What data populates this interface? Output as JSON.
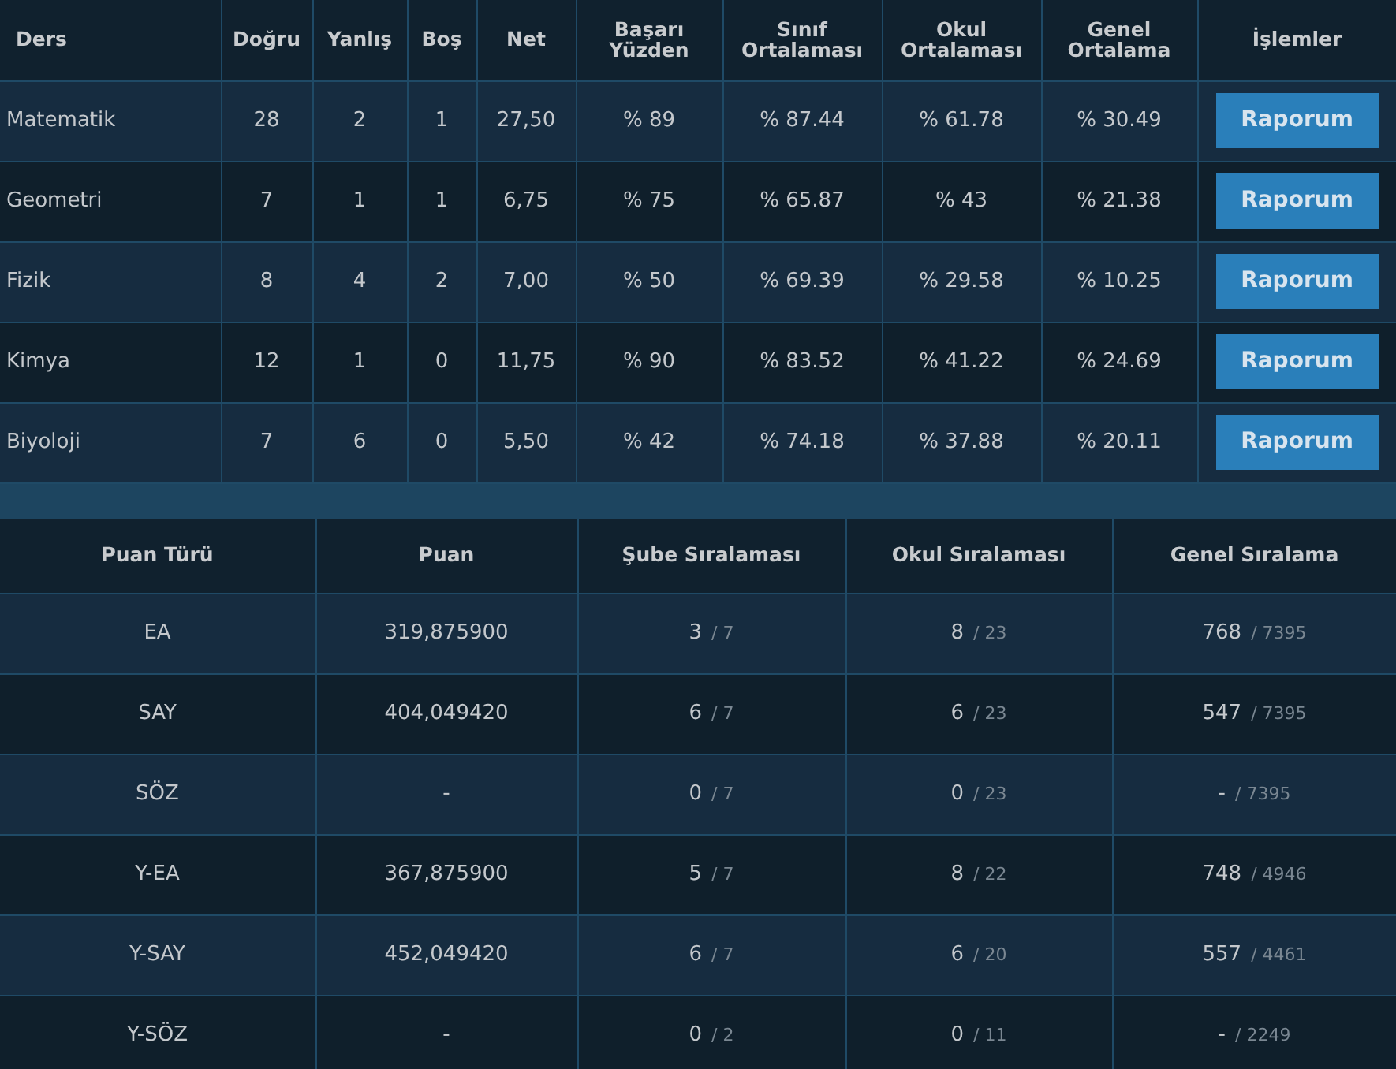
{
  "results_table": {
    "columns": [
      "Ders",
      "Doğru",
      "Yanlış",
      "Boş",
      "Net",
      "Başarı Yüzden",
      "Sınıf Ortalaması",
      "Okul Ortalaması",
      "Genel Ortalama",
      "İşlemler"
    ],
    "rows": [
      {
        "cells": [
          "Matematik",
          "28",
          "2",
          "1",
          "27,50",
          "% 89",
          "% 87.44",
          "% 61.78",
          "% 30.49"
        ],
        "button": "Raporum"
      },
      {
        "cells": [
          "Geometri",
          "7",
          "1",
          "1",
          "6,75",
          "% 75",
          "% 65.87",
          "% 43",
          "% 21.38"
        ],
        "button": "Raporum"
      },
      {
        "cells": [
          "Fizik",
          "8",
          "4",
          "2",
          "7,00",
          "% 50",
          "% 69.39",
          "% 29.58",
          "% 10.25"
        ],
        "button": "Raporum"
      },
      {
        "cells": [
          "Kimya",
          "12",
          "1",
          "0",
          "11,75",
          "% 90",
          "% 83.52",
          "% 41.22",
          "% 24.69"
        ],
        "button": "Raporum"
      },
      {
        "cells": [
          "Biyoloji",
          "7",
          "6",
          "0",
          "5,50",
          "% 42",
          "% 74.18",
          "% 37.88",
          "% 20.11"
        ],
        "button": "Raporum"
      }
    ]
  },
  "score_table": {
    "columns": [
      "Puan Türü",
      "Puan",
      "Şube Sıralaması",
      "Okul Sıralaması",
      "Genel Sıralama"
    ],
    "rows": [
      {
        "type": "EA",
        "score": "319,875900",
        "ranks": [
          {
            "rank": "3",
            "total": "/ 7"
          },
          {
            "rank": "8",
            "total": "/ 23"
          },
          {
            "rank": "768",
            "total": "/ 7395"
          }
        ]
      },
      {
        "type": "SAY",
        "score": "404,049420",
        "ranks": [
          {
            "rank": "6",
            "total": "/ 7"
          },
          {
            "rank": "6",
            "total": "/ 23"
          },
          {
            "rank": "547",
            "total": "/ 7395"
          }
        ]
      },
      {
        "type": "SÖZ",
        "score": "-",
        "ranks": [
          {
            "rank": "0",
            "total": "/ 7"
          },
          {
            "rank": "0",
            "total": "/ 23"
          },
          {
            "rank": "-",
            "total": "/ 7395"
          }
        ]
      },
      {
        "type": "Y-EA",
        "score": "367,875900",
        "ranks": [
          {
            "rank": "5",
            "total": "/ 7"
          },
          {
            "rank": "8",
            "total": "/ 22"
          },
          {
            "rank": "748",
            "total": "/ 4946"
          }
        ]
      },
      {
        "type": "Y-SAY",
        "score": "452,049420",
        "ranks": [
          {
            "rank": "6",
            "total": "/ 7"
          },
          {
            "rank": "6",
            "total": "/ 20"
          },
          {
            "rank": "557",
            "total": "/ 4461"
          }
        ]
      },
      {
        "type": "Y-SÖZ",
        "score": "-",
        "ranks": [
          {
            "rank": "0",
            "total": "/ 2"
          },
          {
            "rank": "0",
            "total": "/ 11"
          },
          {
            "rank": "-",
            "total": "/ 2249"
          }
        ]
      }
    ]
  }
}
